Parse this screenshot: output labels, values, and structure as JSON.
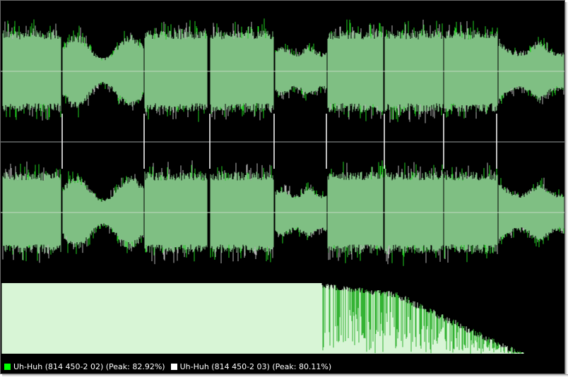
{
  "colors": {
    "background": "#000000",
    "waveform_fill": "#7fbf83",
    "waveform_peak_green": "#1fcf1f",
    "waveform_peak_grey": "#b4b4b4",
    "centerline": "#c0d8c0",
    "channel_divider": "#9aa0a0",
    "marker": "#ffffff",
    "spectrum_light": "#d8f5d6",
    "spectrum_green": "#18a818"
  },
  "legend": [
    {
      "label": "Uh-Huh (814 450-2 02) (Peak: 82.92%)",
      "swatch_color": "#00ff00"
    },
    {
      "label": "Uh-Huh (814 450-2 03) (Peak: 80.11%)",
      "swatch_color": "#ffffff"
    }
  ]
}
